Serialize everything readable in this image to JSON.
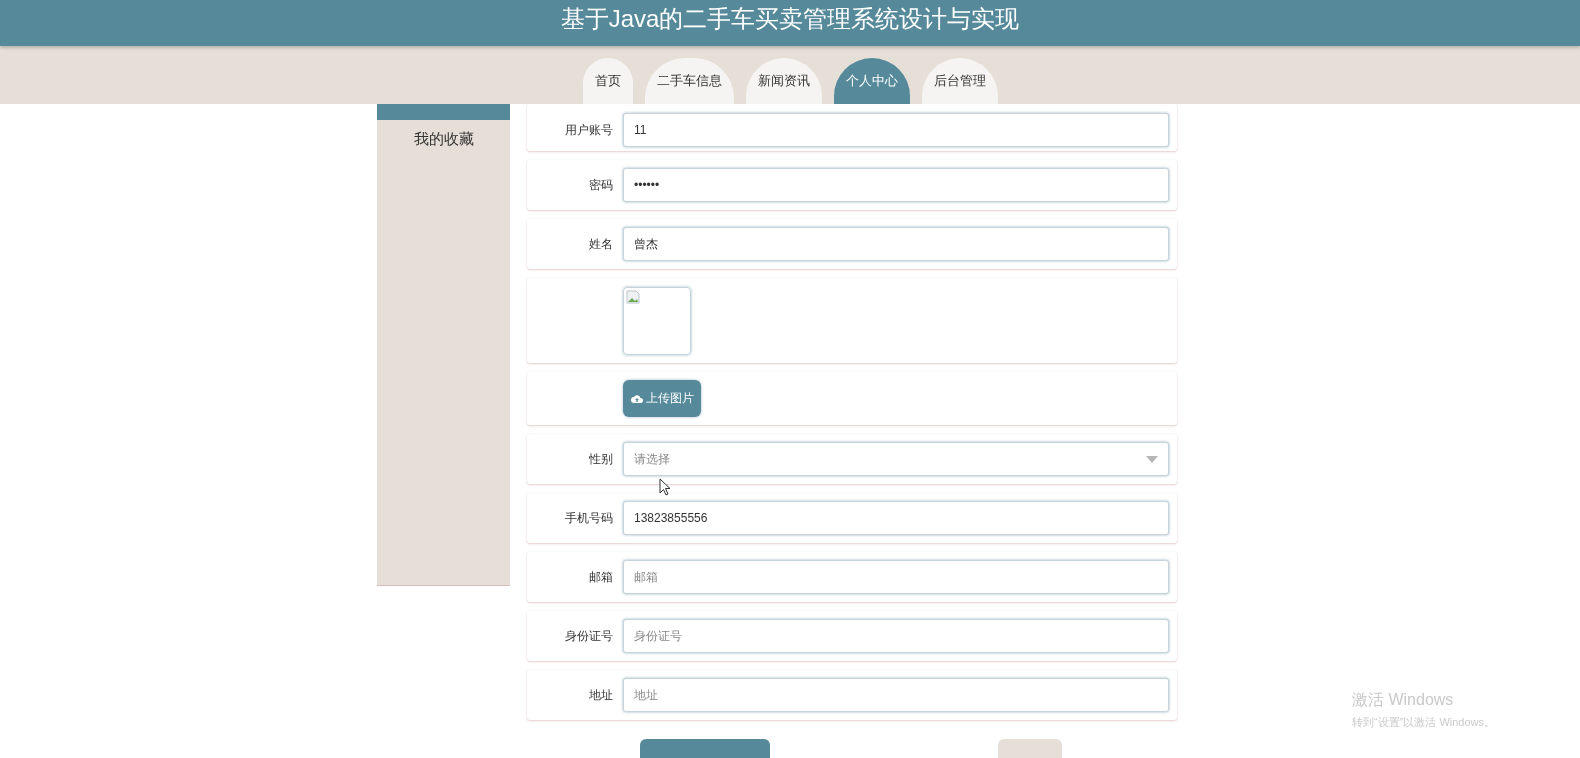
{
  "header": {
    "title": "基于Java的二手车买卖管理系统设计与实现"
  },
  "nav": {
    "tabs": [
      {
        "label": "首页",
        "selected": false
      },
      {
        "label": "二手车信息",
        "selected": false
      },
      {
        "label": "新闻资讯",
        "selected": false
      },
      {
        "label": "个人中心",
        "selected": true
      },
      {
        "label": "后台管理",
        "selected": false
      }
    ]
  },
  "sidebar": {
    "items": [
      {
        "label": "我的收藏"
      }
    ]
  },
  "form": {
    "fields": [
      {
        "kind": "text",
        "label": "用户账号",
        "value": "11"
      },
      {
        "kind": "text",
        "label": "密码",
        "value": "••••••"
      },
      {
        "kind": "text",
        "label": "姓名",
        "value": "曾杰"
      },
      {
        "kind": "image"
      },
      {
        "kind": "upload",
        "button": "上传图片"
      },
      {
        "kind": "select",
        "label": "性别",
        "placeholder": "请选择"
      },
      {
        "kind": "text",
        "label": "手机号码",
        "value": "13823855556"
      },
      {
        "kind": "text",
        "label": "邮箱",
        "placeholder": "邮箱"
      },
      {
        "kind": "text",
        "label": "身份证号",
        "placeholder": "身份证号"
      },
      {
        "kind": "text",
        "label": "地址",
        "placeholder": "地址"
      }
    ],
    "actions": [
      {
        "kind": "primary"
      },
      {
        "kind": "secondary"
      }
    ]
  },
  "os_notice": {
    "title": "激活 Windows",
    "subtitle": "转到“设置”以激活 Windows。"
  }
}
